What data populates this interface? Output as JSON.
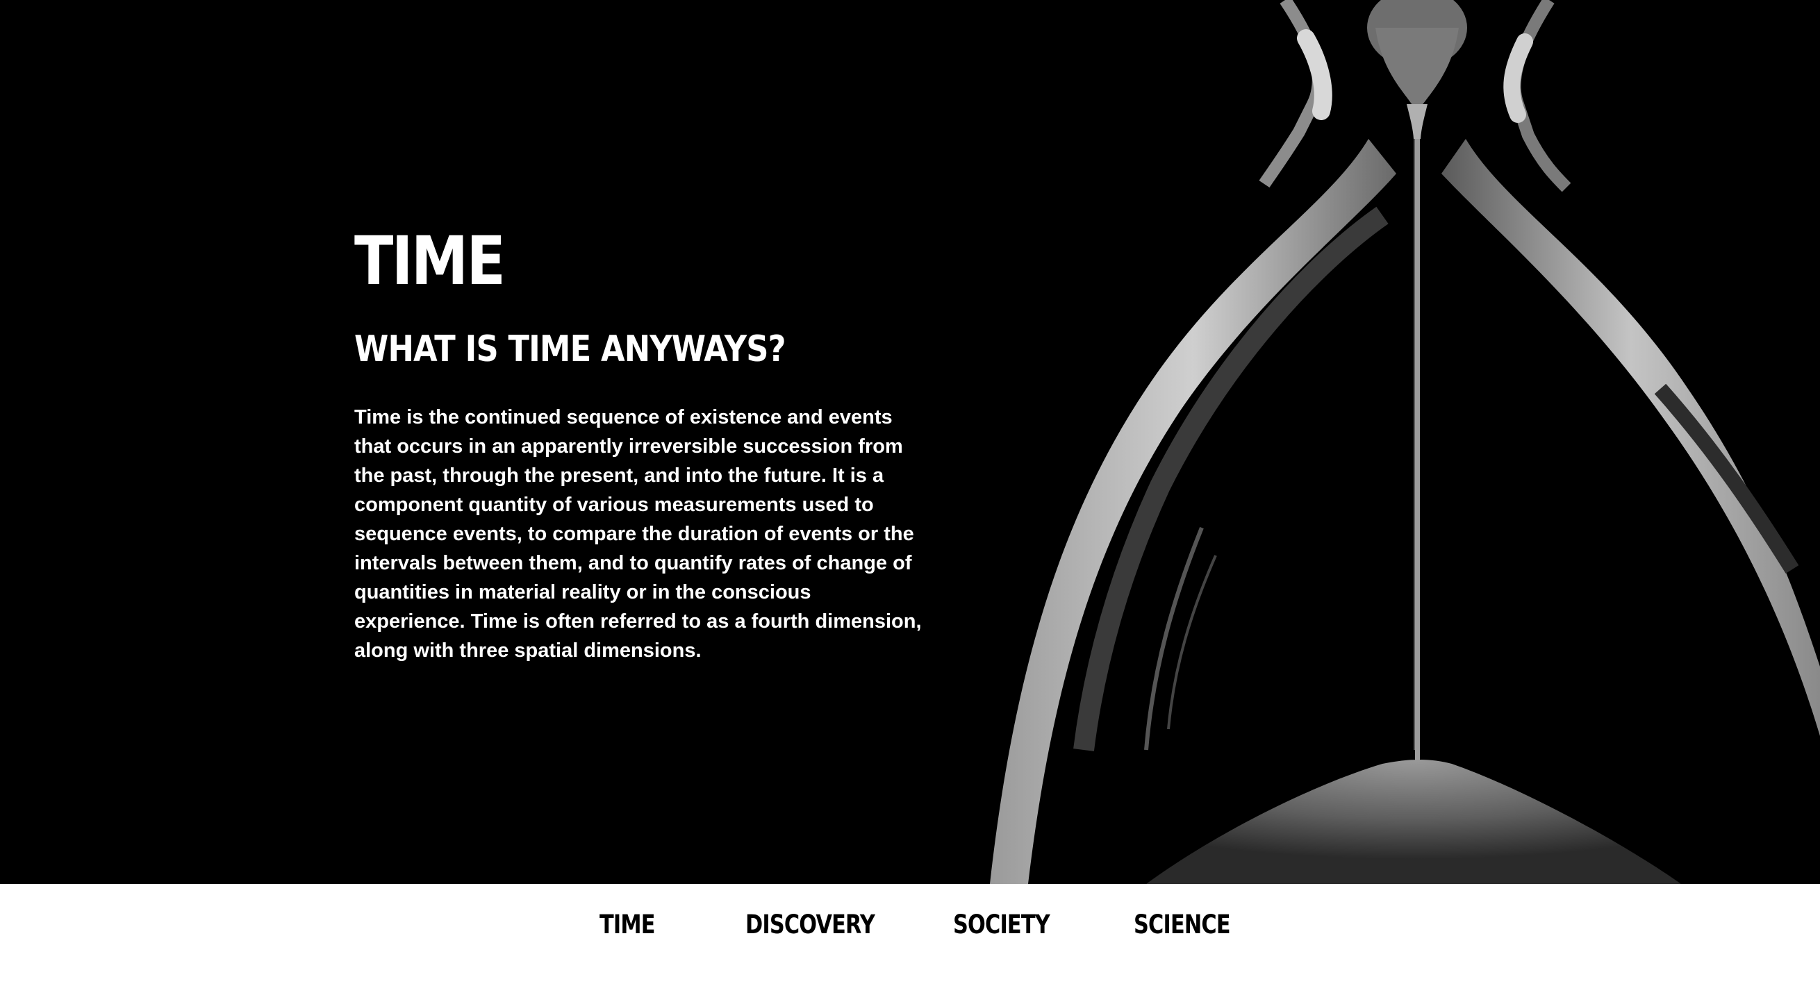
{
  "hero": {
    "title": "TIME",
    "subtitle": "WHAT IS TIME ANYWAYS?",
    "body": "Time is the continued sequence of existence and events that occurs in an apparently irreversible succession from the past, through the present, and into the future. It is a component quantity of various measurements used to sequence events, to compare the duration of events or the intervals between them, and to quantify rates of change of quantities in material reality or in the conscious experience. Time is often referred to as a fourth dimension, along with three spatial dimensions.",
    "image": "hourglass-photo",
    "background_color": "#000000",
    "text_color": "#ffffff"
  },
  "nav": {
    "items": [
      {
        "label": "TIME"
      },
      {
        "label": "DISCOVERY"
      },
      {
        "label": "SOCIETY"
      },
      {
        "label": "SCIENCE"
      }
    ],
    "background_color": "#ffffff",
    "text_color": "#000000"
  }
}
